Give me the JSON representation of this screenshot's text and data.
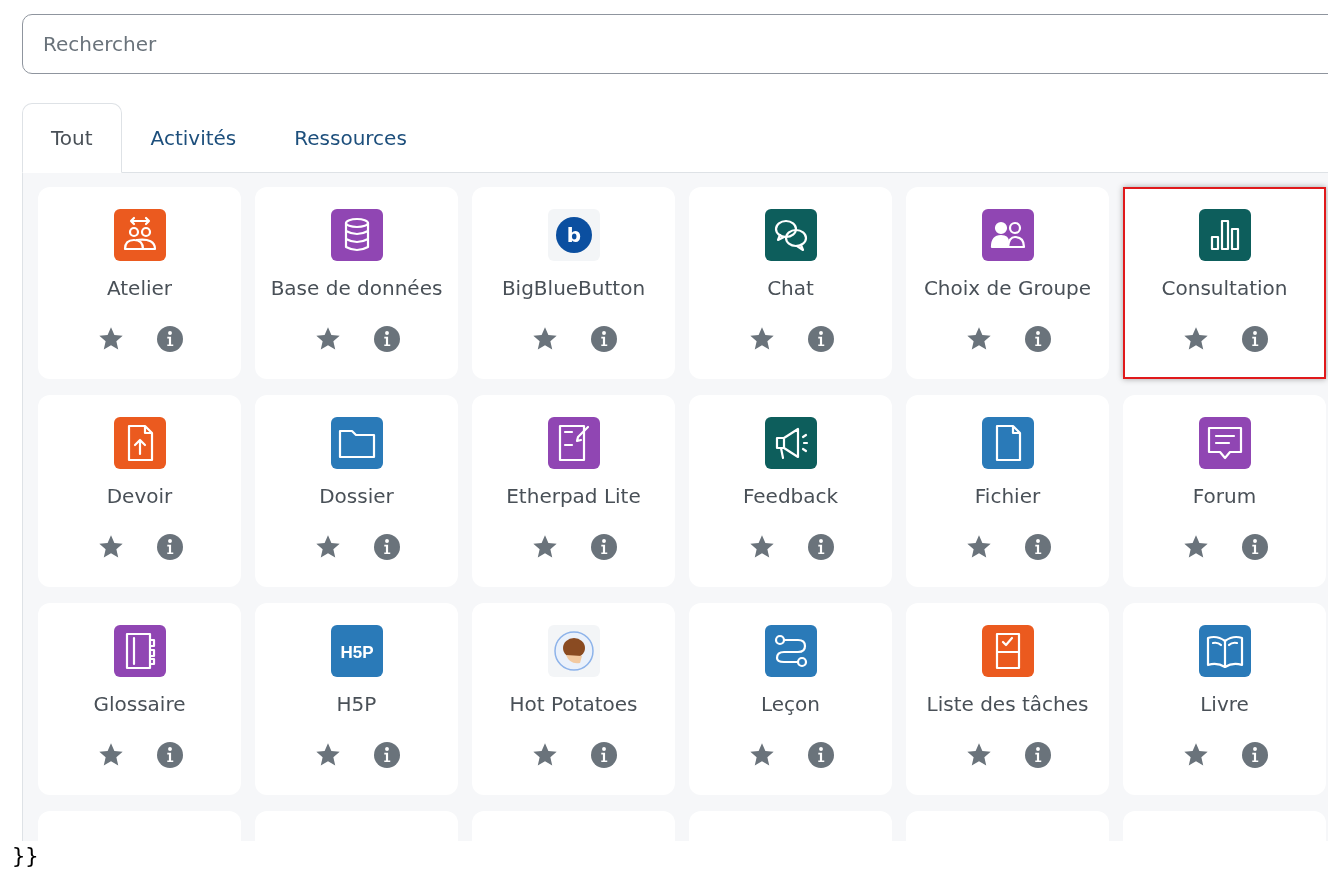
{
  "search": {
    "placeholder": "Rechercher"
  },
  "tabs": [
    {
      "label": "Tout",
      "selected": true
    },
    {
      "label": "Activités",
      "selected": false
    },
    {
      "label": "Ressources",
      "selected": false
    }
  ],
  "modules": [
    {
      "name": "Atelier",
      "kind": "workshop",
      "color": "#eb5a1f",
      "highlighted": false,
      "starred": false
    },
    {
      "name": "Base de données",
      "kind": "database",
      "color": "#9046b3",
      "highlighted": false,
      "starred": false
    },
    {
      "name": "BigBlueButton",
      "kind": "bbb",
      "color": "#0b4fa0",
      "icon_text": "b",
      "highlighted": false,
      "starred": false
    },
    {
      "name": "Chat",
      "kind": "chat",
      "color": "#0d5e5c",
      "highlighted": false,
      "starred": false
    },
    {
      "name": "Choix de Groupe",
      "kind": "group",
      "color": "#9046b3",
      "highlighted": false,
      "starred": false
    },
    {
      "name": "Consultation",
      "kind": "bars",
      "color": "#0d5e5c",
      "highlighted": true,
      "starred": false
    },
    {
      "name": "Devoir",
      "kind": "assign",
      "color": "#eb5a1f",
      "highlighted": false,
      "starred": false
    },
    {
      "name": "Dossier",
      "kind": "folder",
      "color": "#2a7ab8",
      "highlighted": false,
      "starred": false
    },
    {
      "name": "Etherpad Lite",
      "kind": "etherpad",
      "color": "#9046b3",
      "highlighted": false,
      "starred": false
    },
    {
      "name": "Feedback",
      "kind": "megaphone",
      "color": "#0d5e5c",
      "highlighted": false,
      "starred": false
    },
    {
      "name": "Fichier",
      "kind": "file",
      "color": "#2a7ab8",
      "highlighted": false,
      "starred": false
    },
    {
      "name": "Forum",
      "kind": "forum",
      "color": "#9046b3",
      "highlighted": false,
      "starred": false
    },
    {
      "name": "Glossaire",
      "kind": "glossary",
      "color": "#9046b3",
      "highlighted": false,
      "starred": false
    },
    {
      "name": "H5P",
      "kind": "h5p",
      "color": "#2a7ab8",
      "icon_text": "H5P",
      "highlighted": false,
      "starred": false
    },
    {
      "name": "Hot Potatoes",
      "kind": "hotpot",
      "color": "#f3f5f7",
      "highlighted": false,
      "starred": false
    },
    {
      "name": "Leçon",
      "kind": "lesson",
      "color": "#2a7ab8",
      "highlighted": false,
      "starred": false
    },
    {
      "name": "Liste des tâches",
      "kind": "checklist",
      "color": "#eb5a1f",
      "highlighted": false,
      "starred": false
    },
    {
      "name": "Livre",
      "kind": "book",
      "color": "#2a7ab8",
      "highlighted": false,
      "starred": false
    }
  ],
  "footer_text": "}}"
}
